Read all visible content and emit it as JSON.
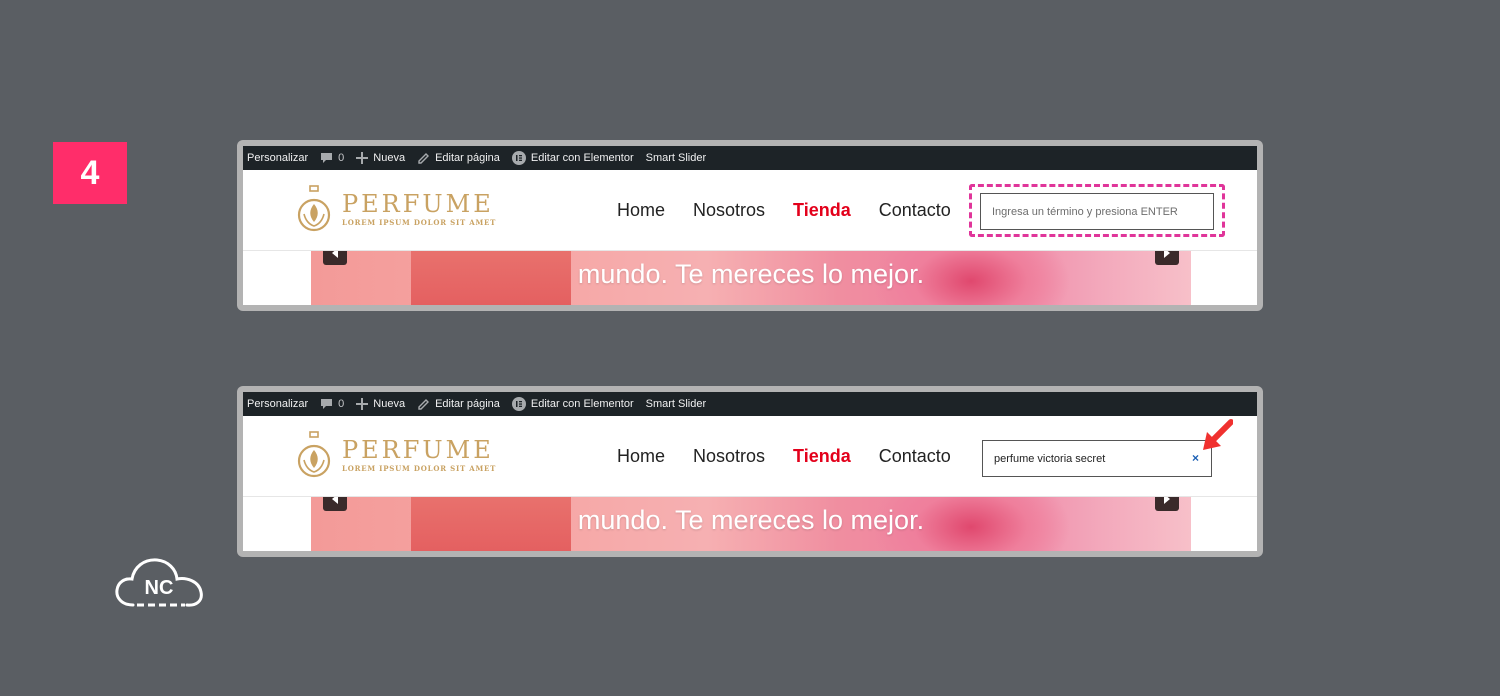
{
  "step_number": "4",
  "admin_bar": {
    "customize": "Personalizar",
    "comments_count": "0",
    "new": "Nueva",
    "edit_page": "Editar página",
    "edit_elementor": "Editar con Elementor",
    "smart_slider": "Smart Slider"
  },
  "logo": {
    "title": "PERFUME",
    "tagline": "LOREM IPSUM DOLOR SIT AMET"
  },
  "nav": {
    "items": [
      "Home",
      "Nosotros",
      "Tienda",
      "Contacto"
    ],
    "active": "Tienda"
  },
  "screenshot_1": {
    "search_placeholder": "Ingresa un término y presiona ENTER"
  },
  "screenshot_2": {
    "search_value": "perfume victoria secret",
    "clear_symbol": "×"
  },
  "slider": {
    "text": "mundo. Te mereces lo mejor."
  },
  "brand_logo_text": "NC",
  "colors": {
    "badge": "#ff2d6a",
    "focus_outline": "#e0359a",
    "active_nav": "#e3001b",
    "logo_gold": "#c9a262",
    "arrow": "#f0312f"
  }
}
